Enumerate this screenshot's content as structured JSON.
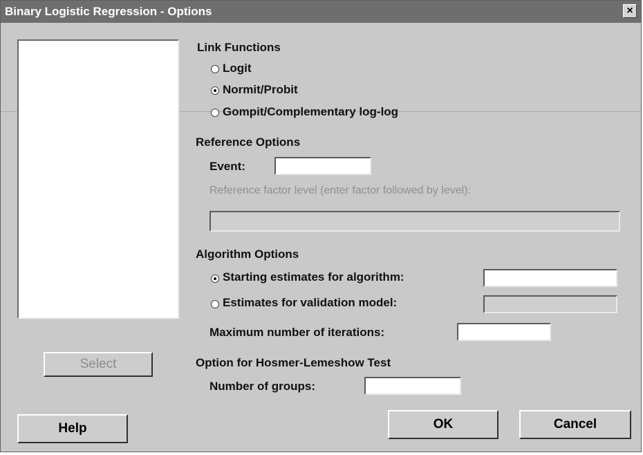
{
  "window": {
    "title": "Binary Logistic Regression - Options",
    "close_glyph": "×"
  },
  "left_panel": {
    "select_label": "Select"
  },
  "link_functions": {
    "heading": "Link Functions",
    "options": [
      {
        "label": "Logit",
        "selected": false
      },
      {
        "label": "Normit/Probit",
        "selected": true
      },
      {
        "label": "Gompit/Complementary log-log",
        "selected": false
      }
    ]
  },
  "reference_options": {
    "heading": "Reference Options",
    "event_label": "Event:",
    "event_value": "",
    "factor_level_label": "Reference factor level (enter factor followed by level):",
    "factor_level_value": ""
  },
  "algorithm_options": {
    "heading": "Algorithm Options",
    "starting_label": "Starting estimates for algorithm:",
    "starting_selected": true,
    "starting_value": "",
    "validation_label": "Estimates for validation model:",
    "validation_selected": false,
    "validation_value": "",
    "max_iter_label": "Maximum number of iterations:",
    "max_iter_value": ""
  },
  "hosmer": {
    "heading": "Option for Hosmer-Lemeshow Test",
    "groups_label": "Number of groups:",
    "groups_value": ""
  },
  "buttons": {
    "help": "Help",
    "ok": "OK",
    "cancel": "Cancel"
  }
}
